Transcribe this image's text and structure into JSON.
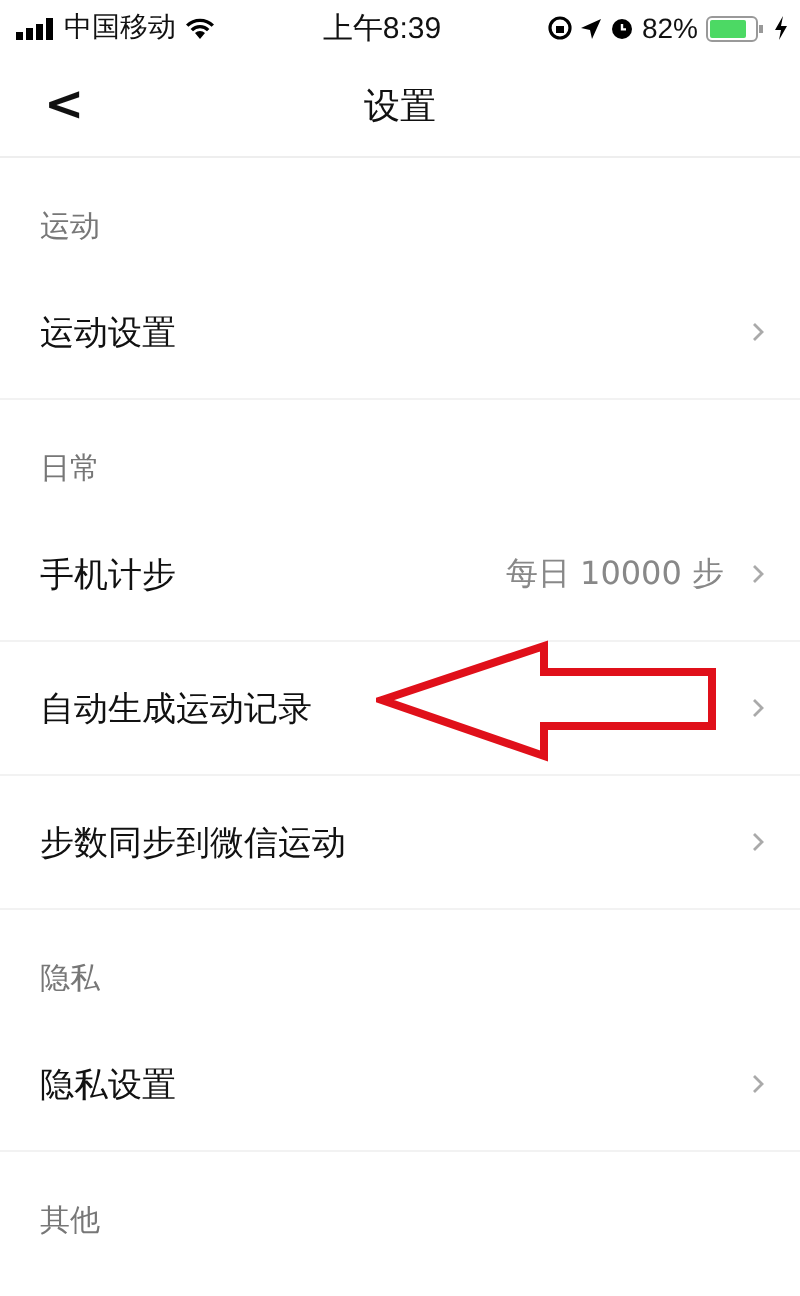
{
  "status_bar": {
    "carrier": "中国移动",
    "time": "上午8:39",
    "battery": "82%"
  },
  "nav": {
    "back": "<",
    "title": "设置"
  },
  "sections": [
    {
      "header": "运动",
      "rows": [
        {
          "label": "运动设置",
          "value": null
        }
      ]
    },
    {
      "header": "日常",
      "rows": [
        {
          "label": "手机计步",
          "value": "每日 10000 步"
        },
        {
          "label": "自动生成运动记录",
          "value": null
        },
        {
          "label": "步数同步到微信运动",
          "value": null
        }
      ]
    },
    {
      "header": "隐私",
      "rows": [
        {
          "label": "隐私设置",
          "value": null
        }
      ]
    },
    {
      "header": "其他"
    }
  ]
}
